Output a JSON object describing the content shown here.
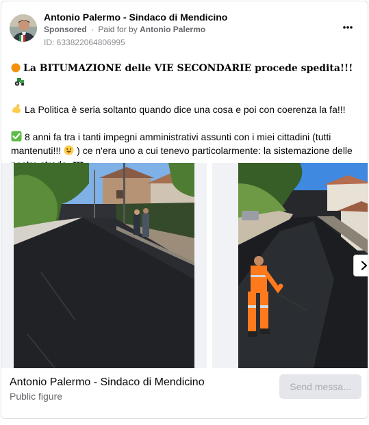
{
  "post": {
    "page_name": "Antonio Palermo - Sindaco di Mendicino",
    "sponsored_label": "Sponsored",
    "separator": "·",
    "paid_for_prefix": "Paid for by",
    "payer": "Antonio Palermo",
    "ad_id": "ID: 633822064806995",
    "more_icon": "ellipsis-icon",
    "paragraphs": {
      "p1_icon": "orange-circle-emoji",
      "p1": "La BITUMAZIONE delle VIE SECONDARIE procede spedita!!!",
      "p1_end_icon": "tractor-emoji",
      "p2_icon": "flexed-biceps-emoji",
      "p2": "La Politica è seria soltanto quando dice una cosa e poi con coerenza la fa!!!",
      "p3_icon": "check-mark-button-emoji",
      "p3_a": "8 anni fa tra i tanti impegni amministrativi assunti con i miei cittadini (tutti mantenuti!!!",
      "p3_mid_icon": "grinning-face-emoji",
      "p3_b": ") ce n'era uno a cui tenevo particolarmente: la sistemazione delle nostre strade",
      "p3_end_icon": "construction-emoji",
      "ellipsis": "..."
    }
  },
  "carousel": {
    "slides": [
      {
        "icon": "photo-street-men-talking"
      },
      {
        "icon": "photo-worker-asphalt"
      }
    ],
    "next_icon": "chevron-right-icon"
  },
  "footer": {
    "name": "Antonio Palermo - Sindaco di Mendicino",
    "category": "Public figure",
    "send_label": "Send messa..."
  },
  "colors": {
    "primary_text": "#050505",
    "secondary_text": "#65676b",
    "button_bg": "#e4e6eb",
    "button_text": "#a8abaf",
    "border": "#dddfe2"
  }
}
